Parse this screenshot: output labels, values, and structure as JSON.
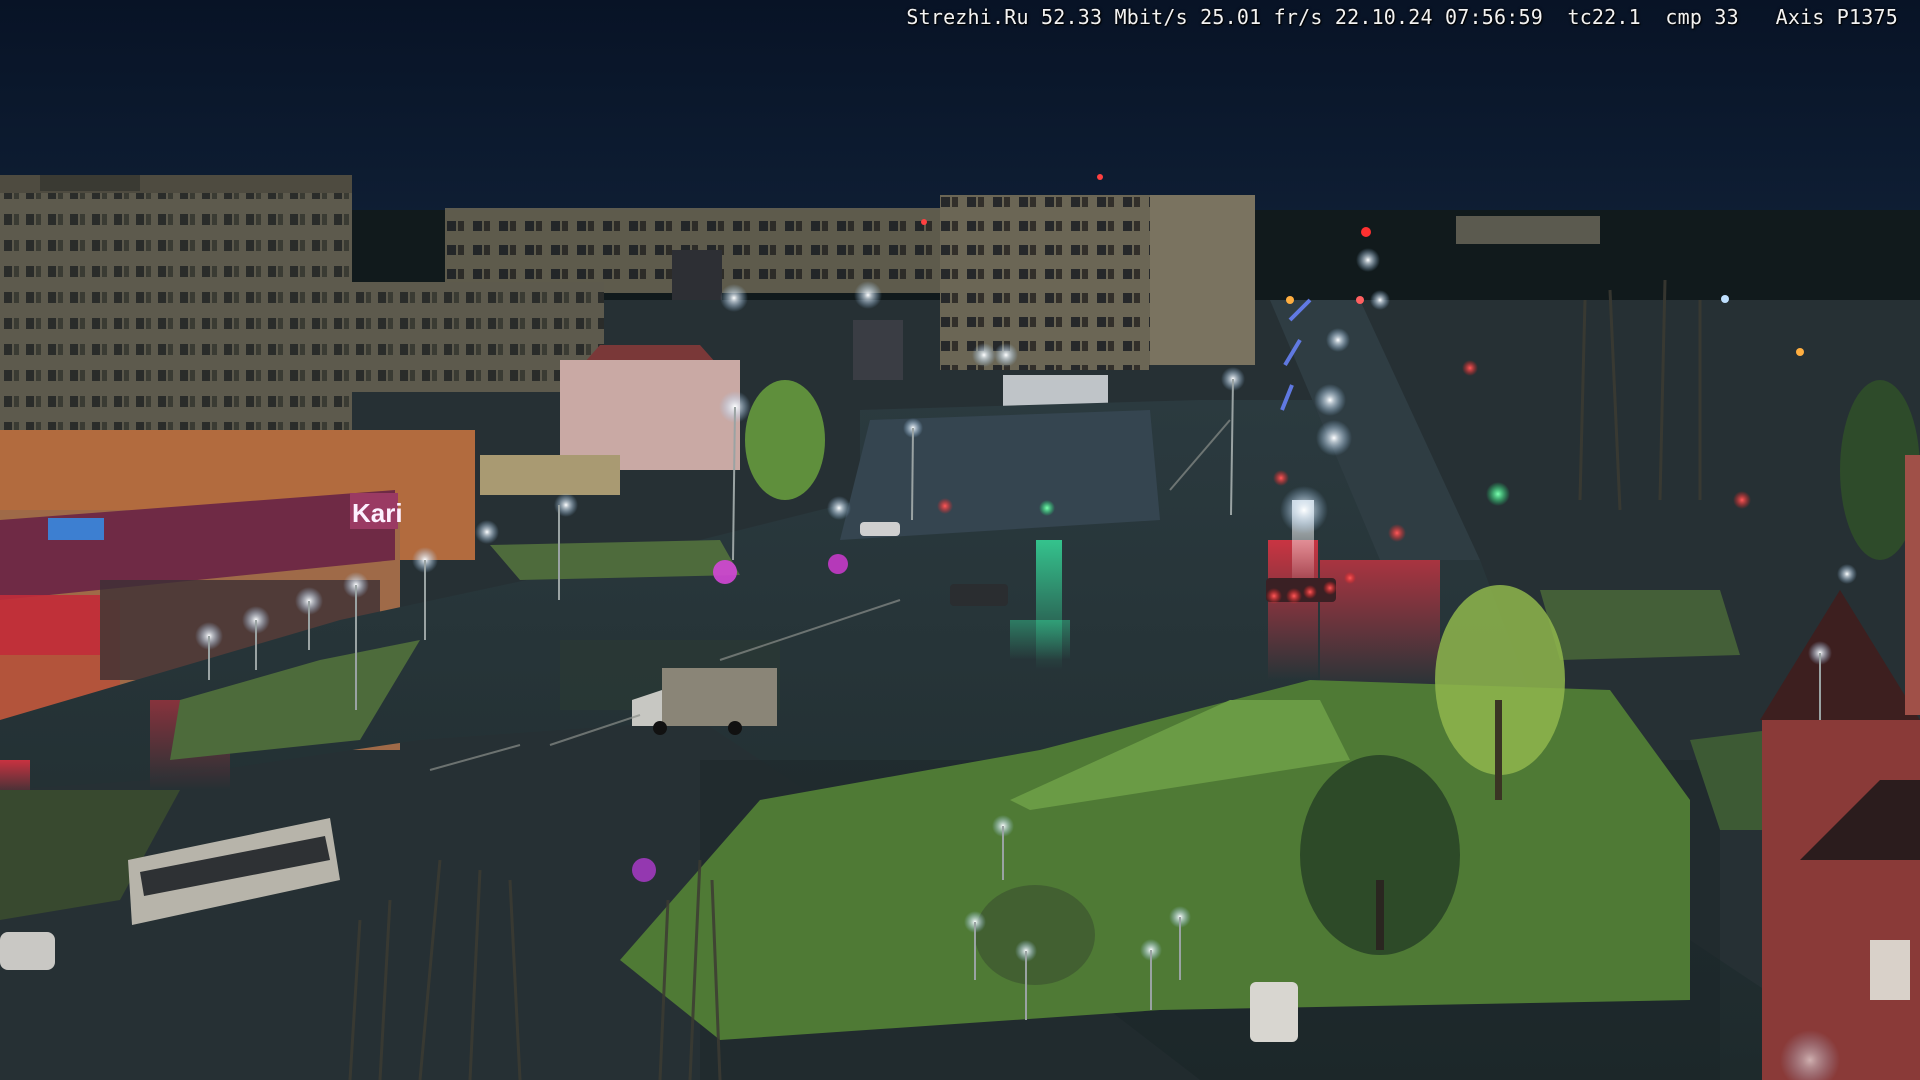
{
  "overlay": {
    "site": "Strezhi.Ru",
    "bitrate": "52.33 Mbit/s",
    "framerate": "25.01 fr/s",
    "date": "22.10.24",
    "time": "07:56:59",
    "temp": "tc22.1",
    "compression": "cmp 33",
    "camera": "Axis P1375"
  },
  "store_sign": "Kari"
}
